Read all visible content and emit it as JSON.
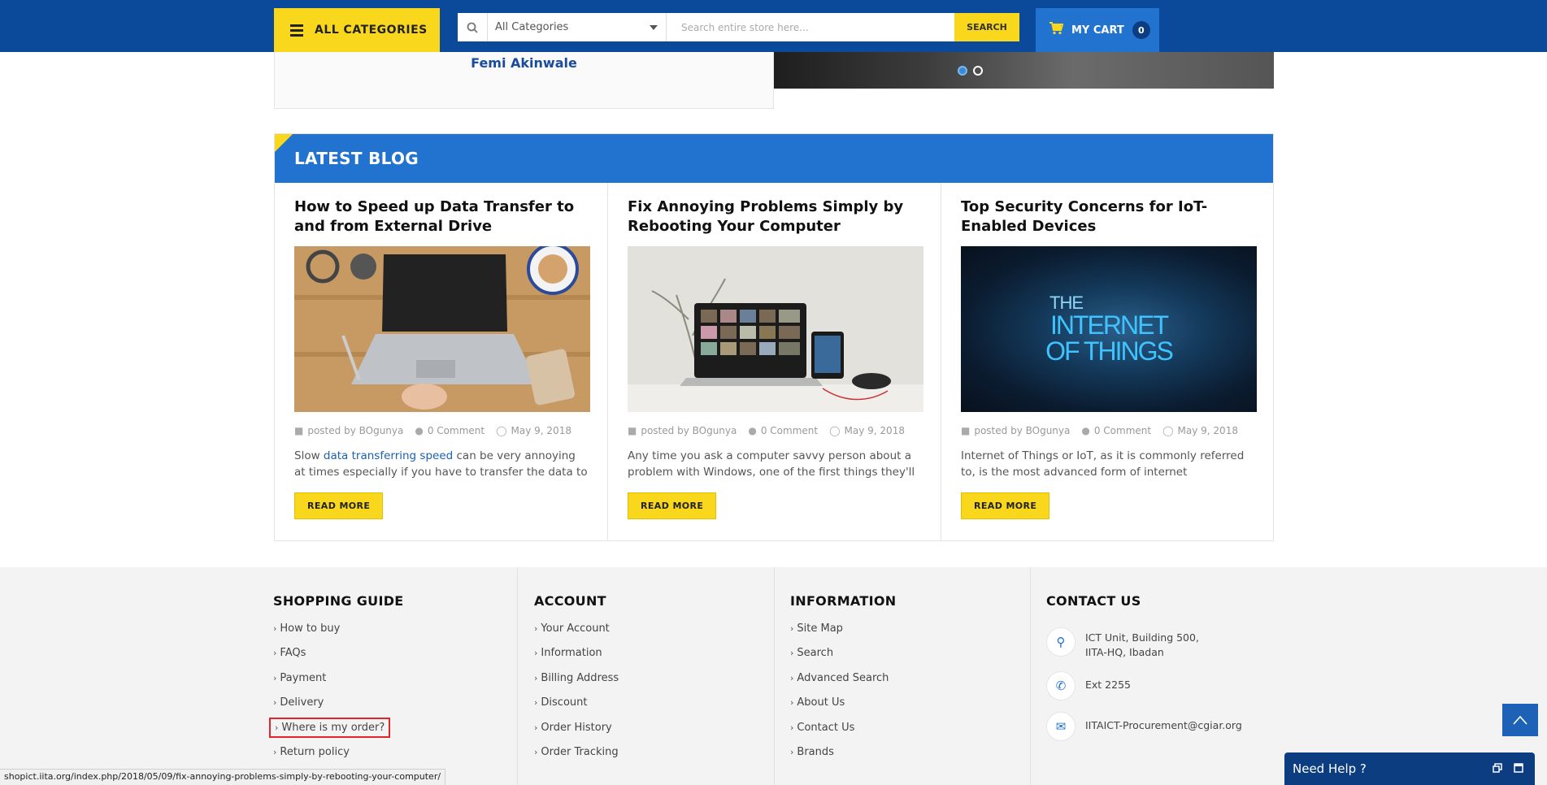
{
  "header": {
    "all_categories_label": "ALL CATEGORIES",
    "category_select_value": "All Categories",
    "search_placeholder": "Search entire store here...",
    "search_button": "SEARCH",
    "cart_label": "MY CART",
    "cart_count": "0"
  },
  "testimonial": {
    "name": "Femi Akinwale"
  },
  "slider": {
    "active_index": 0,
    "dot_count": 2
  },
  "blog": {
    "title": "LATEST BLOG",
    "posts": [
      {
        "title": "How to Speed up Data Transfer to and from External Drive",
        "author": "posted by BOgunya",
        "comments": "0 Comment",
        "date": "May 9, 2018",
        "excerpt_prefix": "Slow ",
        "excerpt_link": "data transferring speed",
        "excerpt_suffix": " can be very annoying at times especially if you have to transfer the data to",
        "read_more": "READ MORE"
      },
      {
        "title": "Fix Annoying Problems Simply by Rebooting Your Computer",
        "author": "posted by BOgunya",
        "comments": "0 Comment",
        "date": "May 9, 2018",
        "excerpt": "Any time you ask a computer savvy person about a problem with Windows, one of the first things they'll",
        "read_more": "READ MORE"
      },
      {
        "title": "Top Security Concerns for IoT-Enabled Devices",
        "author": "posted by BOgunya",
        "comments": "0 Comment",
        "date": "May 9, 2018",
        "excerpt": "Internet of Things or IoT, as it is commonly referred to, is the most advanced form of internet",
        "read_more": "READ MORE",
        "image_text_1": "THE",
        "image_text_2": "INTERNET",
        "image_text_3": "OF THINGS"
      }
    ]
  },
  "footer": {
    "shopping_guide": {
      "title": "SHOPPING GUIDE",
      "items": [
        "How to buy",
        "FAQs",
        "Payment",
        "Delivery",
        "Where is my order?",
        "Return policy"
      ]
    },
    "account": {
      "title": "ACCOUNT",
      "items": [
        "Your Account",
        "Information",
        "Billing Address",
        "Discount",
        "Order History",
        "Order Tracking"
      ]
    },
    "information": {
      "title": "INFORMATION",
      "items": [
        "Site Map",
        "Search",
        "Advanced Search",
        "About Us",
        "Contact Us",
        "Brands"
      ]
    },
    "contact": {
      "title": "CONTACT US",
      "address_line1": "ICT Unit, Building 500,",
      "address_line2": "IITA-HQ, Ibadan",
      "phone": "Ext 2255",
      "email": "IITAICT-Procurement@cgiar.org"
    }
  },
  "chat": {
    "label": "Need Help ?"
  },
  "status_url": "shopict.iita.org/index.php/2018/05/09/fix-annoying-problems-simply-by-rebooting-your-computer/",
  "colors": {
    "header_blue": "#0b4a9b",
    "accent_blue": "#2273cf",
    "accent_yellow": "#f8d71c",
    "highlight_red": "#e0262c"
  }
}
